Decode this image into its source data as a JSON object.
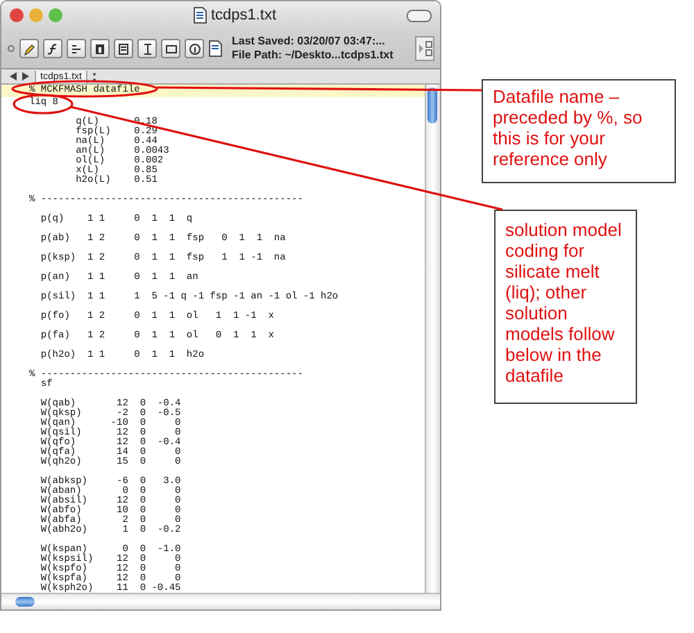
{
  "window": {
    "title": "tcdps1.txt"
  },
  "toolbar": {
    "last_saved": "Last Saved: 03/20/07 03:47:...",
    "file_path": "File Path: ~/Deskto...tcdps1.txt"
  },
  "tabs": [
    {
      "label": "tcdps1.txt",
      "selected": true
    }
  ],
  "highlighted_line": "% MCKFMASH datafile",
  "blocks": [
    {
      "lines": [
        "liq 8"
      ]
    },
    {
      "lines": [
        "        q(L)      0.18",
        "        fsp(L)    0.29",
        "        na(L)     0.44",
        "        an(L)     0.0043",
        "        ol(L)     0.002",
        "        x(L)      0.85",
        "        h2o(L)    0.51"
      ]
    },
    {
      "lines": [
        "% ---------------------------------------------"
      ]
    },
    {
      "lines": [
        "  p(q)    1 1     0  1  1  q"
      ]
    },
    {
      "lines": [
        "  p(ab)   1 2     0  1  1  fsp   0  1  1  na"
      ]
    },
    {
      "lines": [
        "  p(ksp)  1 2     0  1  1  fsp   1  1 -1  na"
      ]
    },
    {
      "lines": [
        "  p(an)   1 1     0  1  1  an"
      ]
    },
    {
      "lines": [
        "  p(sil)  1 1     1  5 -1 q -1 fsp -1 an -1 ol -1 h2o"
      ]
    },
    {
      "lines": [
        "  p(fo)   1 2     0  1  1  ol   1  1 -1  x"
      ]
    },
    {
      "lines": [
        "  p(fa)   1 2     0  1  1  ol   0  1  1  x"
      ]
    },
    {
      "lines": [
        "  p(h2o)  1 1     0  1  1  h2o"
      ]
    },
    {
      "lines": [
        "% ---------------------------------------------",
        "  sf"
      ]
    },
    {
      "lines": [
        "  W(qab)       12  0  -0.4",
        "  W(qksp)      -2  0  -0.5",
        "  W(qan)      -10  0     0",
        "  W(qsil)      12  0     0",
        "  W(qfo)       12  0  -0.4",
        "  W(qfa)       14  0     0",
        "  W(qh2o)      15  0     0"
      ]
    },
    {
      "lines": [
        "  W(abksp)     -6  0   3.0",
        "  W(aban)       0  0     0",
        "  W(absil)     12  0     0",
        "  W(abfo)      10  0     0",
        "  W(abfa)       2  0     0",
        "  W(abh2o)      1  0  -0.2"
      ]
    },
    {
      "lines": [
        "  W(kspan)      0  0  -1.0",
        "  W(kspsil)    12  0     0",
        "  W(kspfo)     12  0     0",
        "  W(kspfa)     12  0     0",
        "  W(ksph2o)    11  0 -0.45"
      ]
    }
  ],
  "annotations": [
    {
      "text": "Datafile name – preceded by %, so this is for your reference only"
    },
    {
      "text": "solution model coding for silicate melt (liq); other solution models follow below in the datafile"
    }
  ]
}
